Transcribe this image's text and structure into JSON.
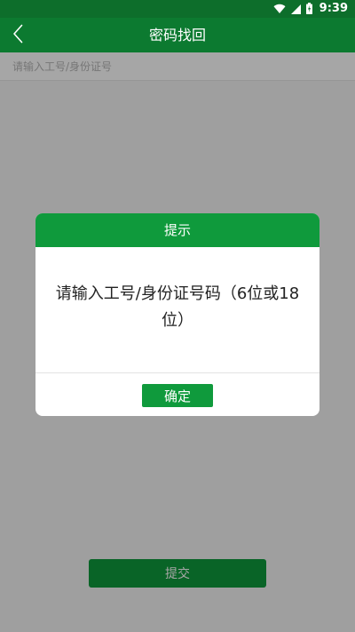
{
  "status_bar": {
    "time": "9:39",
    "icons": [
      "wifi-icon",
      "cell-signal-icon",
      "battery-icon"
    ]
  },
  "toolbar": {
    "title": "密码找回",
    "back_icon": "chevron-left-icon"
  },
  "form": {
    "id_input_placeholder": "请输入工号/身份证号",
    "id_input_value": ""
  },
  "submit_label": "提交",
  "dialog": {
    "title": "提示",
    "message": "请输入工号/身份证号码（6位或18位）",
    "confirm_label": "确定"
  },
  "colors": {
    "status_bar": "#0d6e2b",
    "toolbar": "#0c7a30",
    "accent_green": "#0f9a3c",
    "overlay": "rgba(0,0,0,0.35)"
  }
}
